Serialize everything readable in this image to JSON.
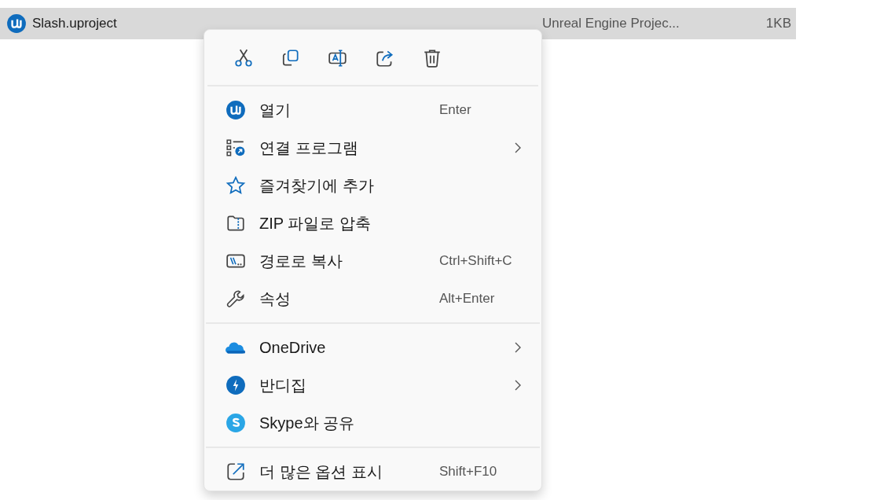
{
  "file_row": {
    "name": "Slash.uproject",
    "type": "Unreal Engine Projec...",
    "size": "1KB",
    "selected": true
  },
  "context_menu": {
    "toolbar": [
      {
        "kind": "cut"
      },
      {
        "kind": "copy"
      },
      {
        "kind": "rename"
      },
      {
        "kind": "share"
      },
      {
        "kind": "delete"
      }
    ],
    "sections": [
      [
        {
          "label": "열기",
          "shortcut": "Enter",
          "submenu": false
        },
        {
          "label": "연결 프로그램",
          "submenu": true
        },
        {
          "label": "즐겨찾기에 추가",
          "submenu": false
        },
        {
          "label": "ZIP 파일로 압축",
          "submenu": false
        },
        {
          "label": "경로로 복사",
          "shortcut": "Ctrl+Shift+C",
          "submenu": false
        },
        {
          "label": "속성",
          "shortcut": "Alt+Enter",
          "submenu": false
        }
      ],
      [
        {
          "label": "OneDrive",
          "submenu": true
        },
        {
          "label": "반디집",
          "submenu": true
        },
        {
          "label": "Skype와 공유",
          "submenu": false
        }
      ],
      [
        {
          "label": "더 많은 옵션 표시",
          "shortcut": "Shift+F10",
          "submenu": false
        }
      ]
    ]
  }
}
